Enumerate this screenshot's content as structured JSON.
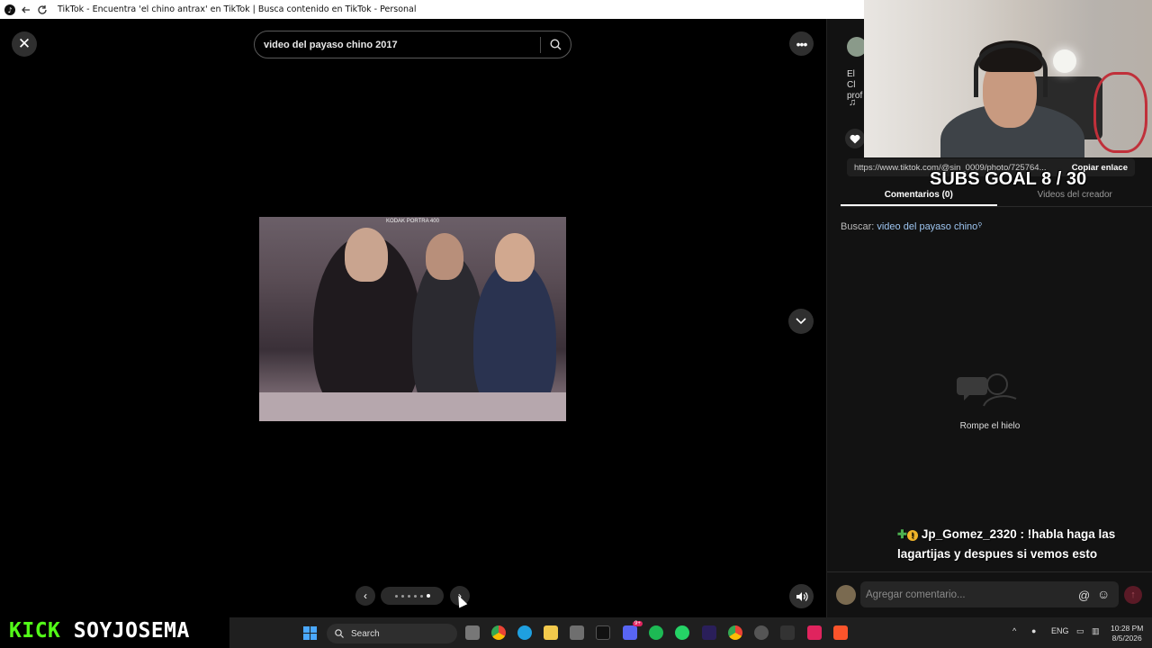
{
  "browser": {
    "window_title": "TikTok - Encuentra 'el chino antrax' en TikTok | Busca contenido en TikTok - Personal"
  },
  "viewer": {
    "search_value": "video del payaso chino 2017",
    "photo_film_text": "KODAK PORTRA 400",
    "photo_pages": 6,
    "photo_active_page": 6
  },
  "sidebar": {
    "description_partial": "El Cl prof",
    "music_icon": "music-note-icon",
    "url": "https://www.tiktok.com/@sin_0009/photo/725764...",
    "copy_label": "Copiar enlace",
    "tabs": [
      {
        "label": "Comentarios (0)",
        "active": true
      },
      {
        "label": "Videos del creador",
        "active": false
      }
    ],
    "search_prefix": "Buscar:",
    "search_link": "video del payaso chino",
    "empty_text": "Rompe el hielo",
    "comment_placeholder": "Agregar comentario..."
  },
  "overlay": {
    "subs_goal": "SUBS GOAL 8 / 30",
    "chat_user": "Jp_Gomez_2320",
    "chat_message": ": !habla haga las lagartijas y despues si vemos esto",
    "kick_prefix": "KICK",
    "kick_name": "SOYJOSEMA"
  },
  "taskbar": {
    "search_label": "Search",
    "lang": "ENG",
    "time": "10:28 PM",
    "date": "8/5/2026",
    "discord_badge": "9+"
  },
  "colors": {
    "accent_link": "#9ec5f0",
    "post_button": "#5a1a26",
    "kick_green": "#53fc18"
  }
}
